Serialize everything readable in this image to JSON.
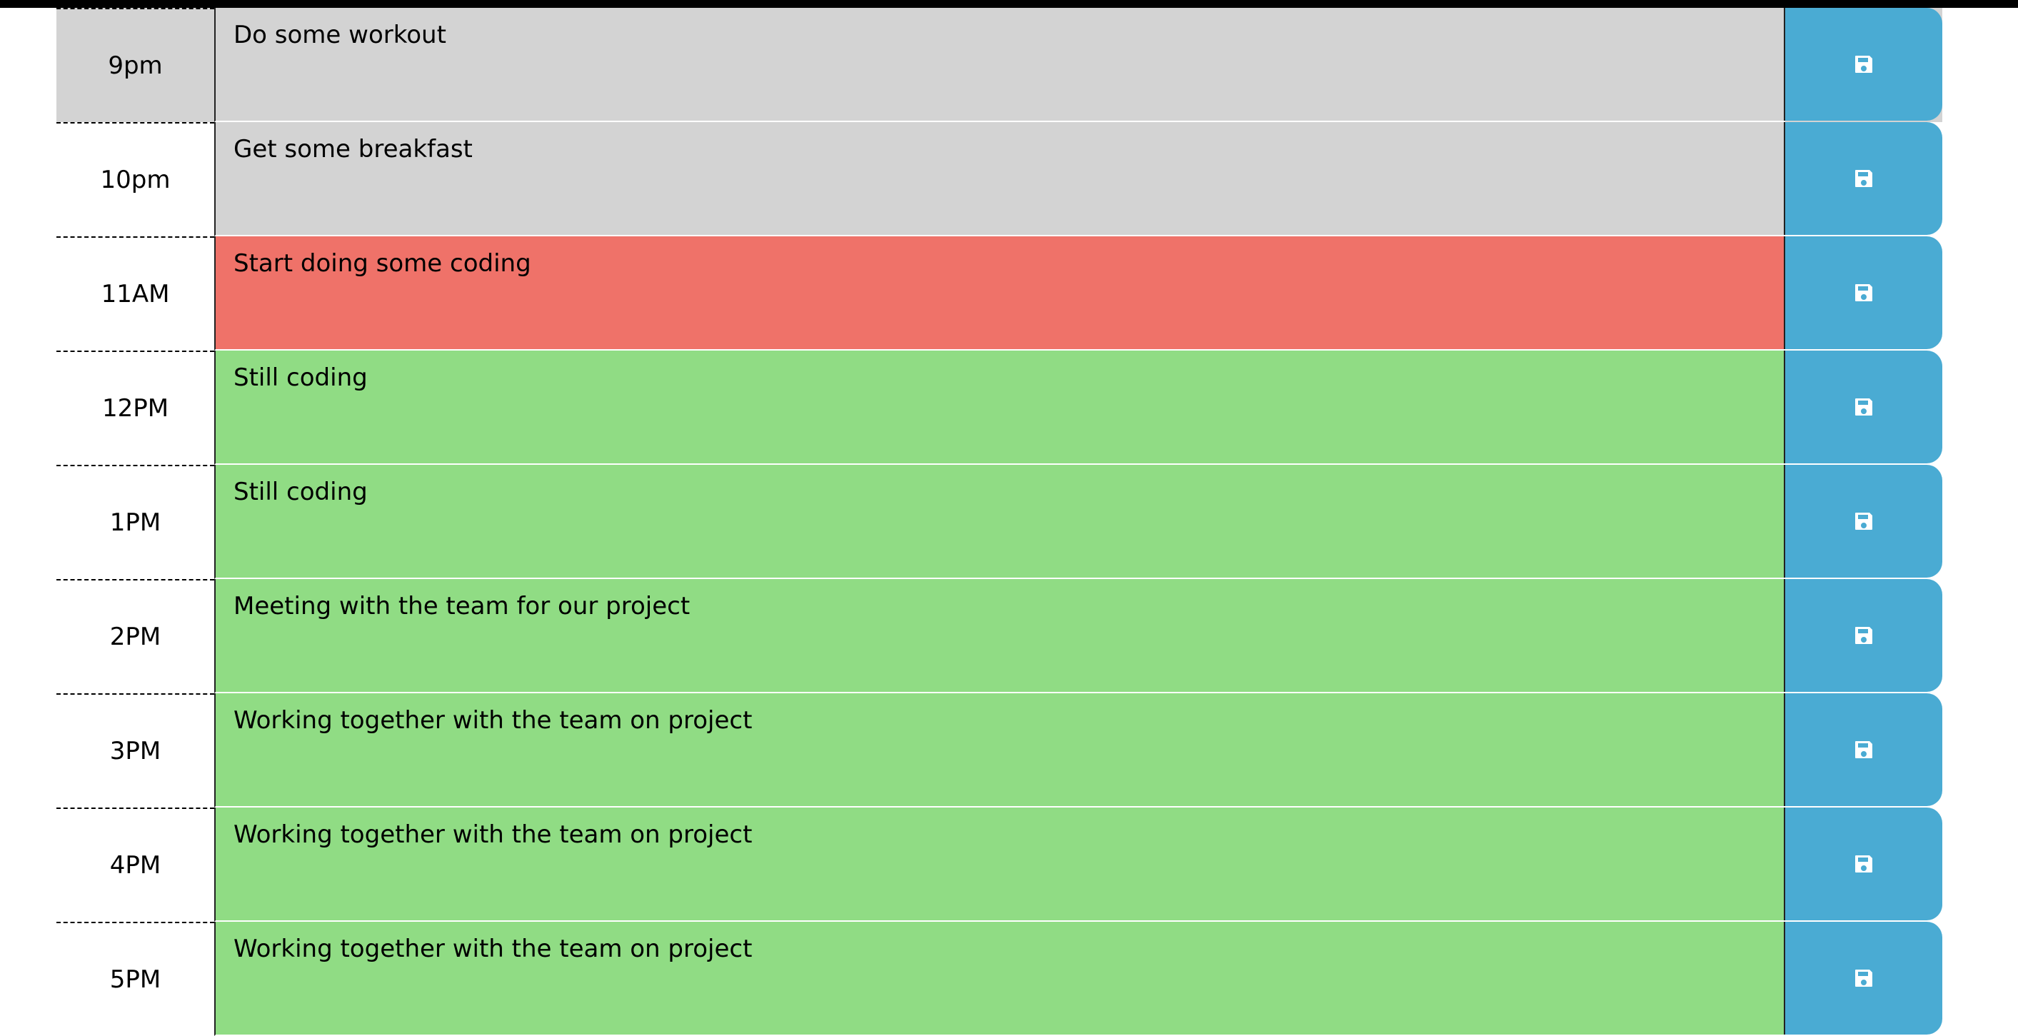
{
  "colors": {
    "past": "#d3d3d3",
    "present": "#ef7269",
    "future": "#90dc84",
    "save_button": "#4aabd3"
  },
  "rows": [
    {
      "hour": "9pm",
      "text": "Do some workout",
      "state": "past"
    },
    {
      "hour": "10pm",
      "text": "Get some breakfast",
      "state": "past"
    },
    {
      "hour": "11AM",
      "text": "Start doing some coding",
      "state": "present"
    },
    {
      "hour": "12PM",
      "text": "Still coding",
      "state": "future"
    },
    {
      "hour": "1PM",
      "text": "Still coding",
      "state": "future"
    },
    {
      "hour": "2PM",
      "text": "Meeting with the team for our project",
      "state": "future"
    },
    {
      "hour": "3PM",
      "text": "Working together with the team on project",
      "state": "future"
    },
    {
      "hour": "4PM",
      "text": "Working together with the team on project",
      "state": "future"
    },
    {
      "hour": "5PM",
      "text": "Working together with the team on project",
      "state": "future"
    }
  ],
  "save_icon": "floppy-disk-icon"
}
